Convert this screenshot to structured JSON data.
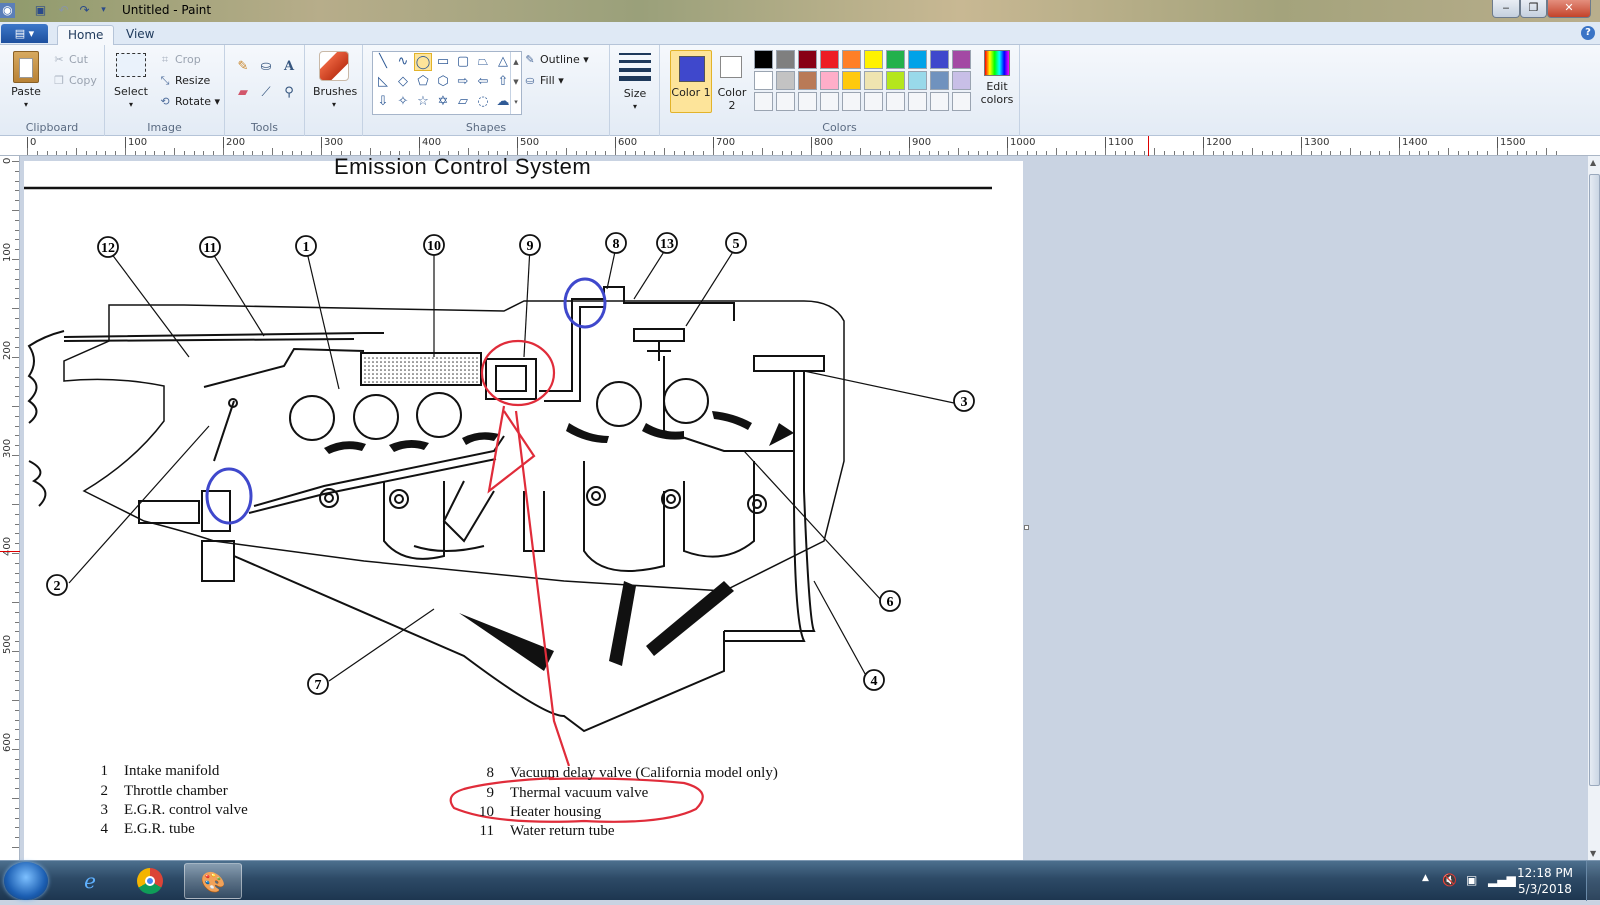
{
  "window": {
    "title": "Untitled - Paint",
    "controls": {
      "minimize": "‒",
      "restore": "❐",
      "close": "✕"
    }
  },
  "ribbon_tabs": {
    "file": "▤ ▾",
    "home": "Home",
    "view": "View"
  },
  "clipboard": {
    "paste": "Paste",
    "cut": "Cut",
    "copy": "Copy",
    "label": "Clipboard"
  },
  "image": {
    "select": "Select",
    "crop": "Crop",
    "resize": "Resize",
    "rotate": "Rotate",
    "label": "Image"
  },
  "tools": {
    "label": "Tools"
  },
  "brushes": {
    "label": "Brushes"
  },
  "shapes": {
    "outline": "Outline",
    "fill": "Fill",
    "label": "Shapes"
  },
  "size": {
    "label": "Size"
  },
  "colors": {
    "color1": "Color 1",
    "color2": "Color 2",
    "edit": "Edit colors",
    "label": "Colors",
    "color1_value": "#3f48cc",
    "palette_row1": [
      "#000000",
      "#7f7f7f",
      "#880015",
      "#ed1c24",
      "#ff7f27",
      "#fff200",
      "#22b14c",
      "#00a2e8",
      "#3f48cc",
      "#a349a4"
    ],
    "palette_row2": [
      "#ffffff",
      "#c3c3c3",
      "#b97a57",
      "#ffaec9",
      "#ffc90e",
      "#efe4b0",
      "#b5e61d",
      "#99d9ea",
      "#7092be",
      "#c8bfe7"
    ]
  },
  "ruler": {
    "h": [
      "0",
      "100",
      "200",
      "300",
      "400",
      "500",
      "600",
      "700",
      "800",
      "900",
      "1000",
      "1100",
      "1200",
      "1300",
      "1400",
      "1500"
    ],
    "v": [
      "0",
      "100",
      "200",
      "300",
      "400",
      "500",
      "600"
    ]
  },
  "document": {
    "heading": "Emission Control System",
    "callouts": [
      "12",
      "11",
      "1",
      "10",
      "9",
      "8",
      "13",
      "5",
      "3",
      "2",
      "6",
      "7",
      "4"
    ],
    "legend_left": [
      {
        "n": "1",
        "t": "Intake manifold"
      },
      {
        "n": "2",
        "t": "Throttle chamber"
      },
      {
        "n": "3",
        "t": "E.G.R. control valve"
      },
      {
        "n": "4",
        "t": "E.G.R. tube"
      }
    ],
    "legend_right": [
      {
        "n": "8",
        "t": "Vacuum delay valve (California model only)"
      },
      {
        "n": "9",
        "t": "Thermal vacuum valve"
      },
      {
        "n": "10",
        "t": "Heater housing"
      },
      {
        "n": "11",
        "t": "Water return tube"
      }
    ]
  },
  "taskbar": {
    "time": "12:18 PM",
    "date": "5/3/2018"
  }
}
